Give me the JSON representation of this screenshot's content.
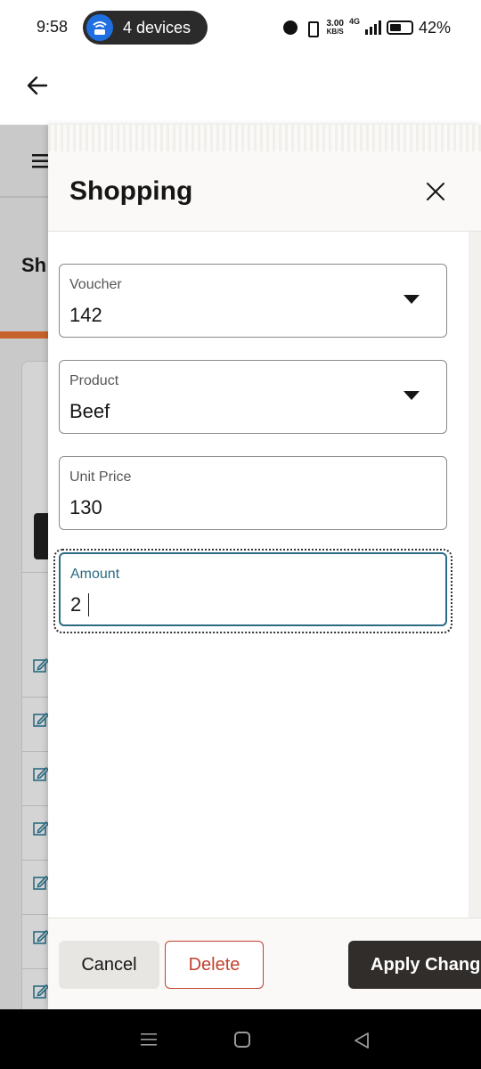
{
  "status_bar": {
    "time": "9:58",
    "hotspot": "4 devices",
    "net_speed_value": "3.00",
    "net_speed_unit": "KB/S",
    "network": "4G",
    "battery": "42%"
  },
  "background": {
    "page_title_partial": "Sh"
  },
  "drawer": {
    "title": "Shopping",
    "fields": [
      {
        "label": "Voucher",
        "value": "142",
        "type": "dropdown"
      },
      {
        "label": "Product",
        "value": "Beef",
        "type": "dropdown"
      },
      {
        "label": "Unit Price",
        "value": "130",
        "type": "text"
      },
      {
        "label": "Amount",
        "value": "2",
        "type": "text",
        "focused": true
      }
    ],
    "cancel_label": "Cancel",
    "delete_label": "Delete",
    "apply_label": "Apply Changes"
  },
  "colors": {
    "accent_focus": "#2b6b83",
    "delete": "#c2412d",
    "primary_button": "#312d2a",
    "hotspot_blue": "#1f6fe0"
  },
  "icons": [
    "back-arrow-icon",
    "close-icon",
    "hamburger-icon",
    "edit-icon",
    "dropdown-arrow-icon",
    "wifi-hotspot-icon"
  ]
}
